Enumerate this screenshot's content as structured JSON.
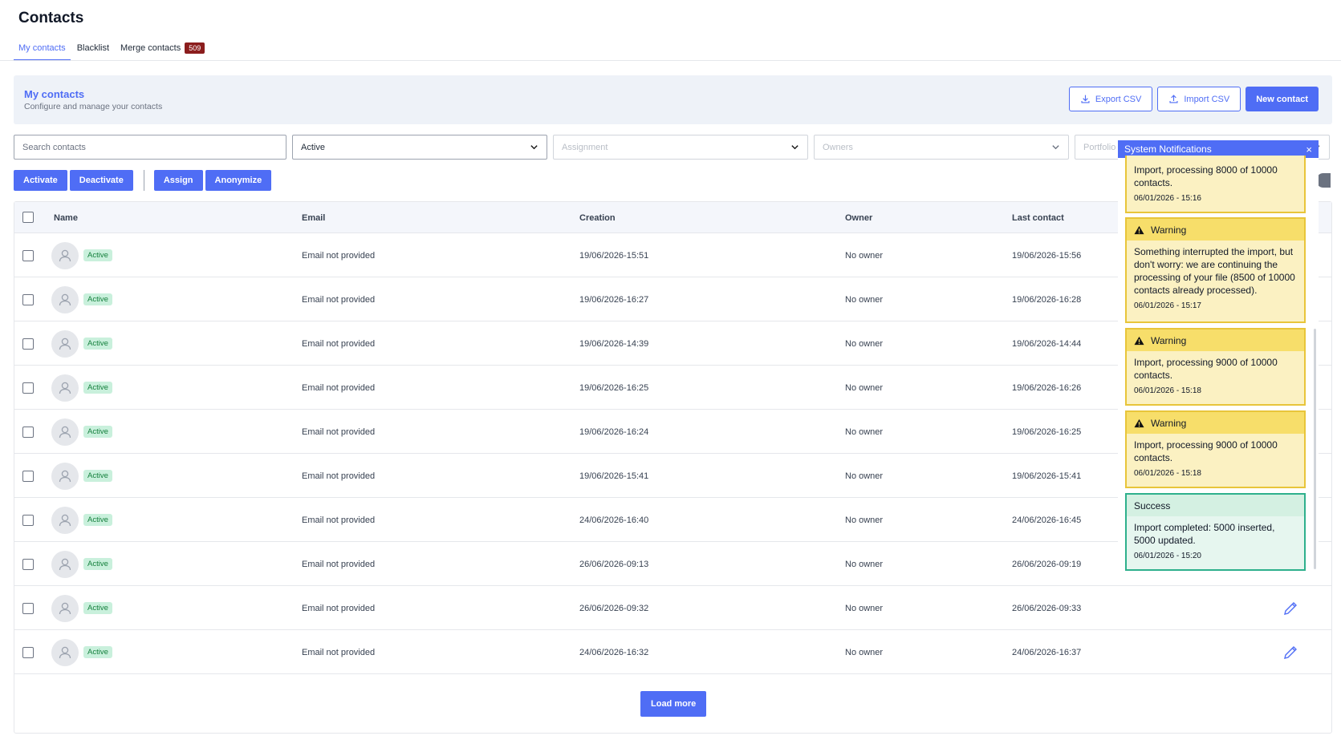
{
  "page": {
    "title": "Contacts"
  },
  "tabs": [
    {
      "label": "My contacts",
      "active": true
    },
    {
      "label": "Blacklist"
    },
    {
      "label": "Merge contacts",
      "badge": "509"
    }
  ],
  "hero": {
    "title": "My contacts",
    "subtitle": "Configure and manage your contacts",
    "export_label": "Export CSV",
    "import_label": "Import CSV",
    "new_label": "New contact"
  },
  "filters": {
    "search_placeholder": "Search contacts",
    "status_value": "Active",
    "assignment_placeholder": "Assignment",
    "owners_placeholder": "Owners",
    "portfolio_placeholder": "Portfolio"
  },
  "bulk_actions": {
    "activate": "Activate",
    "deactivate": "Deactivate",
    "assign": "Assign",
    "anonymize": "Anonymize"
  },
  "table": {
    "headers": {
      "name": "Name",
      "email": "Email",
      "creation": "Creation",
      "owner": "Owner",
      "last_contact": "Last contact"
    },
    "rows": [
      {
        "status": "Active",
        "email": "Email not provided",
        "creation": "19/06/2026-15:51",
        "owner": "No owner",
        "last_contact": "19/06/2026-15:56"
      },
      {
        "status": "Active",
        "email": "Email not provided",
        "creation": "19/06/2026-16:27",
        "owner": "No owner",
        "last_contact": "19/06/2026-16:28"
      },
      {
        "status": "Active",
        "email": "Email not provided",
        "creation": "19/06/2026-14:39",
        "owner": "No owner",
        "last_contact": "19/06/2026-14:44"
      },
      {
        "status": "Active",
        "email": "Email not provided",
        "creation": "19/06/2026-16:25",
        "owner": "No owner",
        "last_contact": "19/06/2026-16:26"
      },
      {
        "status": "Active",
        "email": "Email not provided",
        "creation": "19/06/2026-16:24",
        "owner": "No owner",
        "last_contact": "19/06/2026-16:25"
      },
      {
        "status": "Active",
        "email": "Email not provided",
        "creation": "19/06/2026-15:41",
        "owner": "No owner",
        "last_contact": "19/06/2026-15:41"
      },
      {
        "status": "Active",
        "email": "Email not provided",
        "creation": "24/06/2026-16:40",
        "owner": "No owner",
        "last_contact": "24/06/2026-16:45"
      },
      {
        "status": "Active",
        "email": "Email not provided",
        "creation": "26/06/2026-09:13",
        "owner": "No owner",
        "last_contact": "26/06/2026-09:19"
      },
      {
        "status": "Active",
        "email": "Email not provided",
        "creation": "26/06/2026-09:32",
        "owner": "No owner",
        "last_contact": "26/06/2026-09:33"
      },
      {
        "status": "Active",
        "email": "Email not provided",
        "creation": "24/06/2026-16:32",
        "owner": "No owner",
        "last_contact": "24/06/2026-16:37"
      }
    ],
    "load_more": "Load more"
  },
  "notifications": {
    "title": "System Notifications",
    "close": "×",
    "items": [
      {
        "type": "",
        "text": "Import, processing 8000 of 10000 contacts.",
        "time": "06/01/2026 - 15:16"
      },
      {
        "type": "Warning",
        "text": "Something interrupted the import, but don't worry: we are continuing the processing of your file (8500 of 10000 contacts  already processed).",
        "time": "06/01/2026 - 15:17"
      },
      {
        "type": "Warning",
        "text": "Import, processing 9000 of 10000 contacts.",
        "time": "06/01/2026 - 15:18"
      },
      {
        "type": "Warning",
        "text": "Import, processing 9000 of 10000 contacts.",
        "time": "06/01/2026 - 15:18"
      },
      {
        "type": "Success",
        "text": "Import completed: 5000 inserted, 5000 updated.",
        "time": "06/01/2026 - 15:20"
      }
    ]
  },
  "colors": {
    "accent": "#4f6df5",
    "warning_bg": "#fbf1c2",
    "success_border": "#2eb08c",
    "badge": "#8b1d1d"
  }
}
